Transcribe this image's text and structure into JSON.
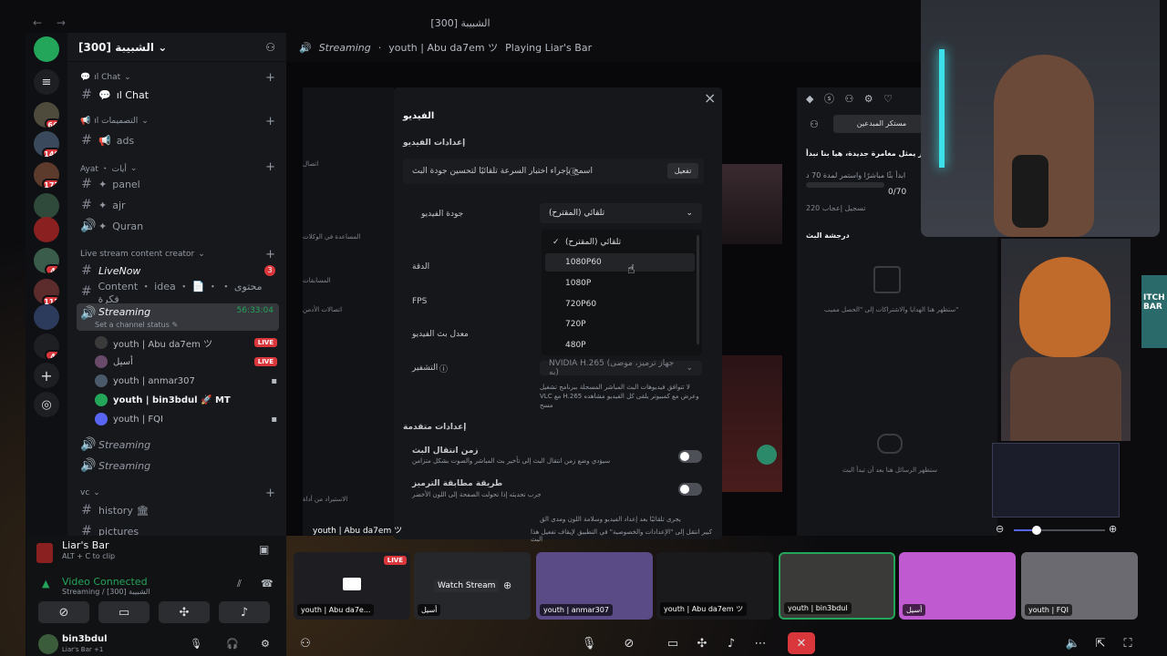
{
  "window": {
    "title": "الشبيبة [300]",
    "back": "← →"
  },
  "colors": {
    "accent": "#5865f2",
    "live": "#da373c",
    "green": "#23a55a",
    "bg": "#0c0c0f"
  },
  "server": {
    "name": "الشبيبة [300]",
    "chevron": "⌄"
  },
  "rail_badges": [
    "66",
    "140",
    "177",
    "112",
    "4",
    "1",
    "4"
  ],
  "channels": {
    "cat_chat": "ıl Chat",
    "chat": "ıl Chat",
    "cat_designs": "ıl التصميمات",
    "ads": "ads",
    "cat_ayat": "Ayat ・ أيات",
    "panel": "panel",
    "ajr": "ajr",
    "quran": "Quran",
    "cat_live": "Live stream content creator",
    "livenow": "LiveNow",
    "livenow_badge": "3",
    "content": "Content ・ idea ・ 📄 ・ محتوى ・ فكرة",
    "streaming": "Streaming",
    "streaming_time": "56:33:04",
    "streaming_status": "Set a channel status ✎",
    "streaming2": "Streaming",
    "streaming3": "Streaming",
    "cat_vc": "vc",
    "history": "history 🏛",
    "pictures": "pictures"
  },
  "voice_users": [
    {
      "name": "youth | Abu da7em ツ",
      "badge": "LIVE"
    },
    {
      "name": "أسيل",
      "badge": "LIVE"
    },
    {
      "name": "youth | anmar307",
      "badge": ""
    },
    {
      "name": "youth | bin3bdul 🚀 MT",
      "badge": ""
    },
    {
      "name": "youth | FQI",
      "badge": ""
    }
  ],
  "activity": {
    "game": "Liar's Bar",
    "hint": "ALT + C to clip"
  },
  "voice": {
    "status": "Video Connected",
    "channel": "Streaming / الشبيبة [300]"
  },
  "me": {
    "name": "bin3bdul",
    "status": "Liar's Bar +1"
  },
  "main_header": {
    "channel": "Streaming",
    "user": "youth | Abu da7em ツ",
    "activity": "Playing Liar's Bar"
  },
  "dialog": {
    "title": "الفيديو",
    "section_settings": "إعدادات الفيديو",
    "auto_test": "اسمح بإجراء اختبار السرعة تلقائيًا لتحسين جودة البث",
    "enable": "تفعيل",
    "quality_label": "جودة الفيديو",
    "quality_value": "تلقائي (المقترح)",
    "resolution_label": "الدقة",
    "fps_label": "FPS",
    "bitrate_label": "معدل بث الفيديو",
    "encoder_label": "التشفير",
    "encoder_value": "NVIDIA H.265 (جهاز ترميز، موصى به)",
    "encoder_note": "لا تتوافق فيديوهات البث المباشر المسجلة ببرنامج تشغيل VLC مع H.265 وعرض مع كمبيوتر يلقى كل الفيديو مشاهده مسح",
    "section_advanced": "إعدادات متقدمة",
    "latency_title": "زمن انتقال البث",
    "latency_desc": "سيؤدي وضع زمن انتقال البث إلى تأخير بث المباشر والصوت بشكل متزامن",
    "encoding_title": "طريقة مطابقة الترميز",
    "encoding_desc": "جرب تحديثه إذا تحولت الصفحة إلى اللون الأخضر",
    "footer": "يجرى تلقائيًا بعد إعداد الفيديو وسلامة اللون ومدى الق",
    "footer2": "كبير انتقل إلى \"الإعدادات والخصوصية\" في التطبيق لإيقاف تفعيل هذا البث",
    "close": "×"
  },
  "dropdown": {
    "options": [
      "تلقائي (المقترح)",
      "1080P60",
      "1080P",
      "720P60",
      "720P",
      "480P"
    ],
    "selected": 0,
    "hover": 1
  },
  "side_menu": [
    "اتصال",
    "المساعدة في الوكلات",
    "المسابقات",
    "اتصالات الأدمن",
    "الاستيراد من أداة"
  ],
  "rpanel": {
    "tab": "مستكر المبدعين",
    "title": "بث مباشر يمثل مغامرة جديدة، هيا بنا نبدأ",
    "subtitle": "ابدأ بثًا مباشرًا واستمر لمدة 70 د",
    "progress_value": "0/70",
    "progress_fraction": 0.0,
    "goal": "220 تسجيل إعجاب",
    "section": "درجشة البث",
    "gifts_empty": "ستظهر هنا الهدايا والاشتراكات إلى \"الحصل مميب\"",
    "chat_empty": "ستظهر الرسائل هنا بعد أن تبدأ البث"
  },
  "overlay_user": "youth | Abu da7em ツ",
  "tiles": [
    {
      "name": "youth | Abu da7e...",
      "badge": "LIVE"
    },
    {
      "name": "أسيل",
      "label": "Watch Stream"
    },
    {
      "name": "youth | anmar307"
    },
    {
      "name": "youth | Abu da7em ツ"
    },
    {
      "name": "youth | bin3bdul"
    },
    {
      "name": "أسيل"
    },
    {
      "name": "youth | FQI"
    }
  ],
  "zoom": {
    "level_fraction": 0.25
  }
}
